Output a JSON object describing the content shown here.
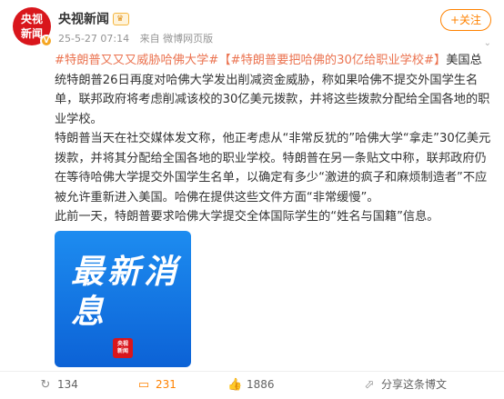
{
  "header": {
    "avatar_text": "央视\n新闻",
    "author": "央视新闻",
    "badge": "",
    "time": "25-5-27 07:14",
    "source": "来自 微博网页版",
    "follow_label": "+关注",
    "dropdown_icon": "chevron-down-icon"
  },
  "post": {
    "topic1": "#特朗普又又又威胁哈佛大学#",
    "topic2": "【#特朗普要把哈佛的30亿给职业学校#】",
    "intro": "美国总统特朗普26日再度对哈佛大学发出削减资金威胁，称如果哈佛不提交外国学生名单，联邦政府将考虑削减该校的30亿美元拨款，并将这些拨款分配给全国各地的职业学校。",
    "para2": "特朗普当天在社交媒体发文称，他正考虑从“非常反犹的”哈佛大学“拿走”30亿美元拨款，并将其分配给全国各地的职业学校。特朗普在另一条贴文中称，联邦政府仍在等待哈佛大学提交外国学生名单，以确定有多少“激进的疯子和麻烦制造者”不应被允许重新进入美国。哈佛在提供这些文件方面“非常缓慢”。",
    "para3": "此前一天，特朗普要求哈佛大学提交全体国际学生的“姓名与国籍”信息。"
  },
  "image": {
    "title": "最新消息",
    "logo_text": "央视\n新闻",
    "bg_color": "#1a86ee"
  },
  "actions": {
    "repost_count": "134",
    "comment_count": "231",
    "like_count": "1886",
    "share_label": "分享这条博文"
  },
  "colors": {
    "accent": "#ff8200",
    "topic": "#eb7350",
    "brand_red": "#d9161c"
  }
}
